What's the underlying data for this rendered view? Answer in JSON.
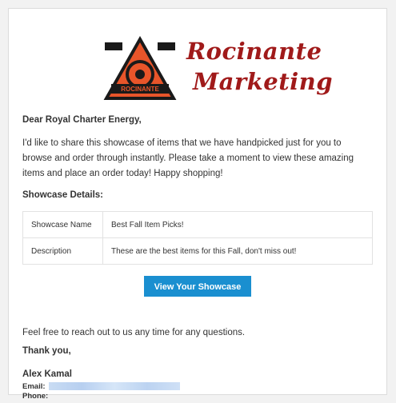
{
  "brand": {
    "line1": "Rocinante",
    "line2": "Marketing",
    "emblem_text": "ROCINANTE",
    "color": "#a01a1a"
  },
  "greeting": "Dear Royal Charter Energy,",
  "intro": "I'd like to share this showcase of items that we have handpicked just for you to browse and order through instantly. Please take a moment to view these amazing items and place an order today! Happy shopping!",
  "showcase": {
    "title": "Showcase Details:",
    "rows": [
      {
        "label": "Showcase Name",
        "value": "Best Fall Item Picks!"
      },
      {
        "label": "Description",
        "value": "These are the best items for this Fall, don't miss out!"
      }
    ]
  },
  "button": {
    "label": "View Your Showcase",
    "color": "#1a8fd0"
  },
  "closing": "Feel free to reach out to us any time for any questions.",
  "thanks": "Thank you,",
  "signature": {
    "name": "Alex Kamal",
    "email_label": "Email:",
    "phone_label": "Phone:"
  }
}
